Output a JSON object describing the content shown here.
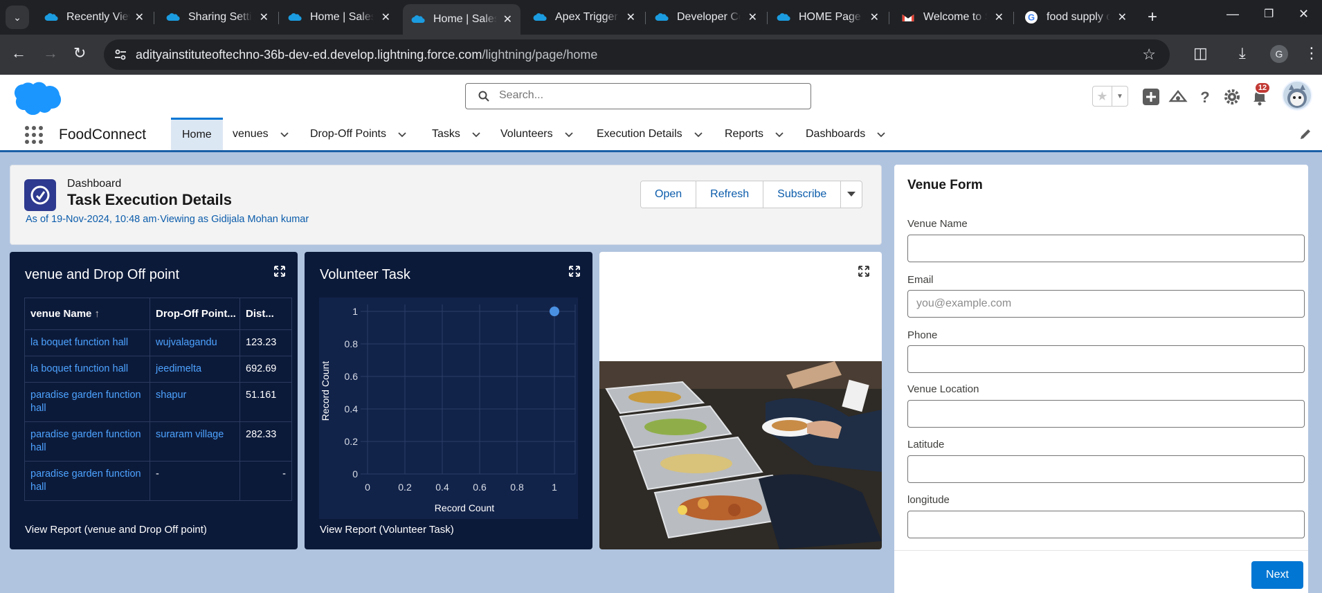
{
  "browser": {
    "tabs": [
      {
        "label": "Recently Viewed",
        "icon": "salesforce-icon"
      },
      {
        "label": "Sharing Settings",
        "icon": "salesforce-icon"
      },
      {
        "label": "Home | Salesforce",
        "icon": "salesforce-icon"
      },
      {
        "label": "Home | Salesforce",
        "icon": "salesforce-icon",
        "active": true
      },
      {
        "label": "Apex Triggers",
        "icon": "salesforce-icon"
      },
      {
        "label": "Developer Console",
        "icon": "salesforce-icon"
      },
      {
        "label": "HOME Page",
        "icon": "salesforce-icon"
      },
      {
        "label": "Welcome to Salesforce",
        "icon": "gmail-icon"
      },
      {
        "label": "food supply chain",
        "icon": "google-icon"
      }
    ],
    "url_host": "adityainstituteoftechno-36b-dev-ed.develop.lightning.force.com",
    "url_path": "/lightning/page/home",
    "profile_initial": "G"
  },
  "sf_header": {
    "search_placeholder": "Search...",
    "notification_count": "12"
  },
  "app_nav": {
    "app_name": "FoodConnect",
    "items": [
      {
        "label": "Home",
        "active": true
      },
      {
        "label": "venues"
      },
      {
        "label": "Drop-Off Points"
      },
      {
        "label": "Tasks"
      },
      {
        "label": "Volunteers"
      },
      {
        "label": "Execution Details"
      },
      {
        "label": "Reports"
      },
      {
        "label": "Dashboards"
      }
    ]
  },
  "dashboard": {
    "type_label": "Dashboard",
    "title": "Task Execution Details",
    "as_of": "As of 19-Nov-2024, 10:48 am·Viewing as Gidijala Mohan kumar",
    "buttons": {
      "open": "Open",
      "refresh": "Refresh",
      "subscribe": "Subscribe"
    }
  },
  "widget_table": {
    "title": "venue and Drop Off point",
    "columns": [
      "venue Name",
      "Drop-Off Point...",
      "Dist..."
    ],
    "sort_indicator": "↑",
    "rows": [
      [
        "la boquet function hall",
        "wujvalagandu",
        "123.23"
      ],
      [
        "la boquet function hall",
        "jeedimelta",
        "692.69"
      ],
      [
        "paradise garden function hall",
        "shapur",
        "51.161"
      ],
      [
        "paradise garden function hall",
        "suraram village",
        "282.33"
      ],
      [
        "paradise garden function hall",
        "-",
        "-"
      ]
    ],
    "footer": "View Report (venue and Drop Off point)"
  },
  "widget_chart": {
    "title": "Volunteer Task",
    "footer": "View Report (Volunteer Task)"
  },
  "chart_data": {
    "type": "scatter",
    "title": "Volunteer Task",
    "xlabel": "Record Count",
    "ylabel": "Record Count",
    "xlim": [
      0,
      1
    ],
    "ylim": [
      0,
      1
    ],
    "xticks": [
      "0",
      "0.2",
      "0.4",
      "0.6",
      "0.8",
      "1"
    ],
    "yticks": [
      "0",
      "0.2",
      "0.4",
      "0.6",
      "0.8",
      "1"
    ],
    "points": [
      {
        "x": 1,
        "y": 1
      }
    ],
    "grid": true,
    "point_color": "#4a90e2"
  },
  "venue_form": {
    "title": "Venue Form",
    "fields": [
      {
        "label": "Venue Name",
        "value": "",
        "placeholder": ""
      },
      {
        "label": "Email",
        "value": "",
        "placeholder": "you@example.com"
      },
      {
        "label": "Phone",
        "value": "",
        "placeholder": ""
      },
      {
        "label": "Venue Location",
        "value": "",
        "placeholder": ""
      },
      {
        "label": "Latitude",
        "value": "",
        "placeholder": ""
      },
      {
        "label": "longitude",
        "value": "",
        "placeholder": ""
      }
    ],
    "next_label": "Next"
  },
  "colors": {
    "brand_blue": "#0176d3",
    "widget_bg": "#0c1a3a",
    "link_blue": "#4da3ff",
    "page_bg": "#b0c4df"
  }
}
